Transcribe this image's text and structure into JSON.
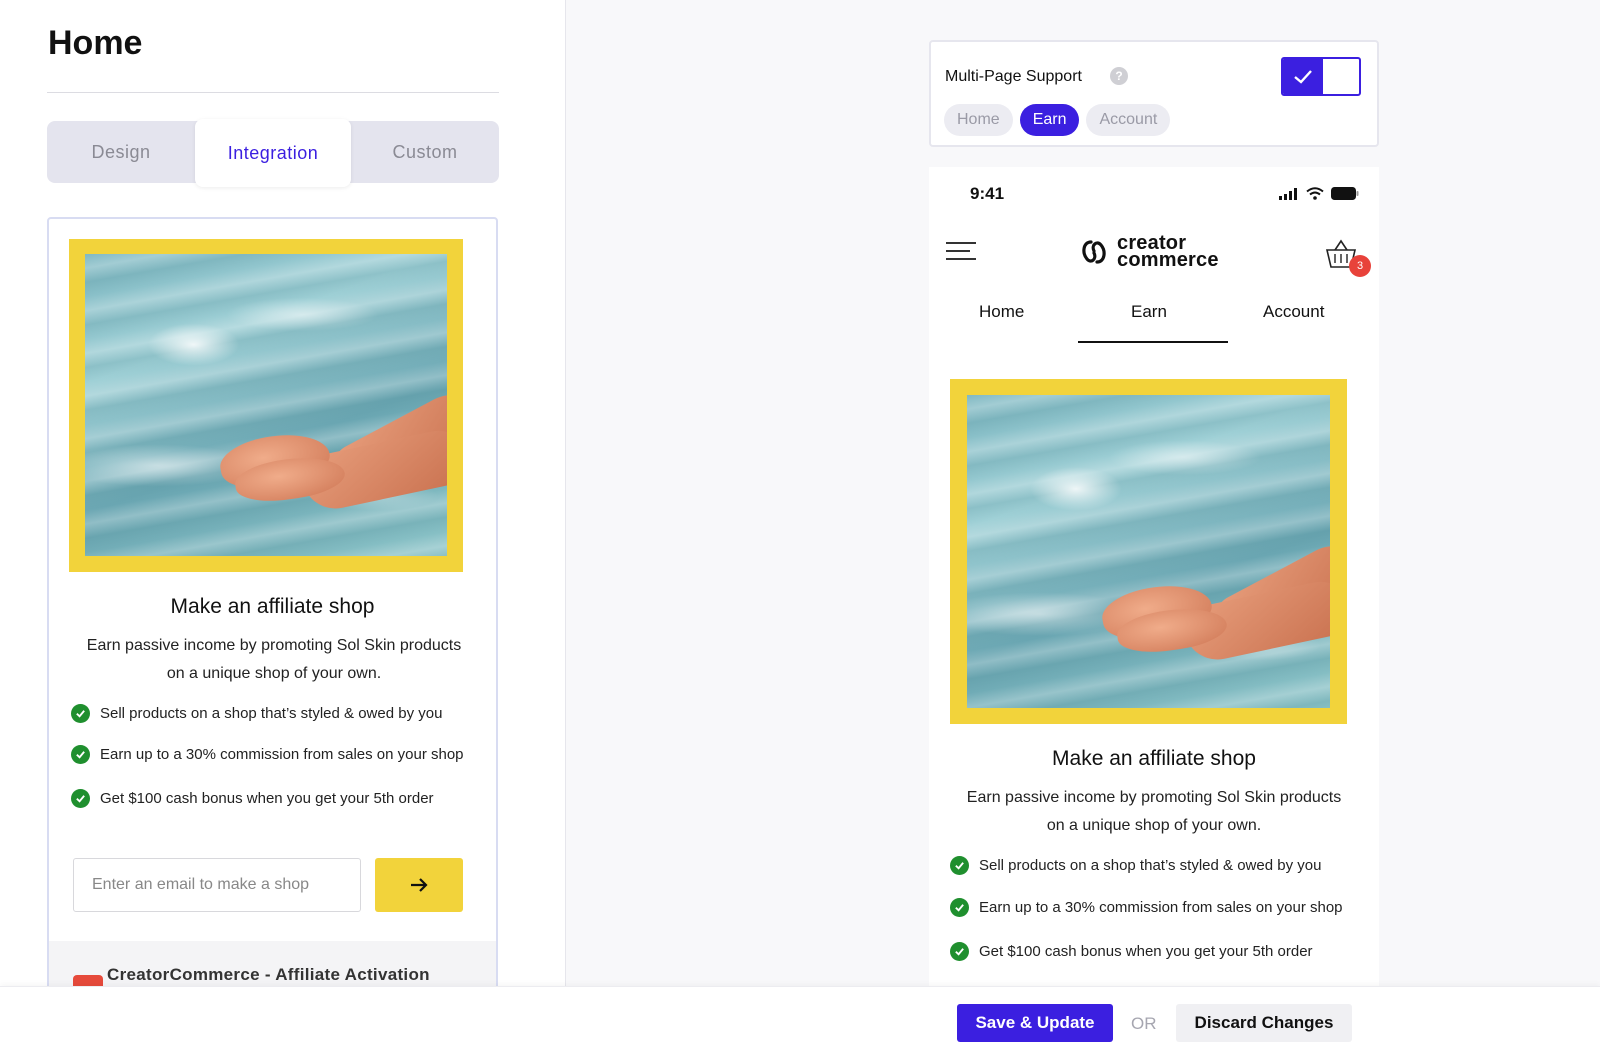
{
  "page": {
    "title": "Home"
  },
  "tabs": [
    {
      "label": "Design",
      "active": false
    },
    {
      "label": "Integration",
      "active": true
    },
    {
      "label": "Custom",
      "active": false
    }
  ],
  "preview": {
    "heading": "Make an affiliate shop",
    "description": "Earn passive income by promoting Sol Skin products on a unique shop of your own.",
    "features": [
      "Sell products on a shop that’s styled & owed by you",
      "Earn up to a 30% commission from sales on your shop",
      "Get $100 cash bonus when you get your 5th order"
    ],
    "email_placeholder": "Enter an email to make a shop",
    "submit_icon": "arrow-right-icon",
    "footer_title": "CreatorCommerce - Affiliate Activation"
  },
  "multi_page": {
    "label": "Multi-Page Support",
    "help": "?",
    "enabled": true,
    "pages": [
      {
        "label": "Home",
        "active": false
      },
      {
        "label": "Earn",
        "active": true
      },
      {
        "label": "Account",
        "active": false
      }
    ]
  },
  "phone": {
    "time": "9:41",
    "brand_line1": "creator",
    "brand_line2": "commerce",
    "cart_count": "3",
    "nav": [
      "Home",
      "Earn",
      "Account"
    ],
    "active_nav": "Earn"
  },
  "actions": {
    "save_label": "Save & Update",
    "or_label": "OR",
    "discard_label": "Discard Changes"
  },
  "colors": {
    "accent": "#3b1fe0",
    "hero_frame": "#f2d33b",
    "check": "#1f8f2e",
    "badge": "#e8423a"
  }
}
